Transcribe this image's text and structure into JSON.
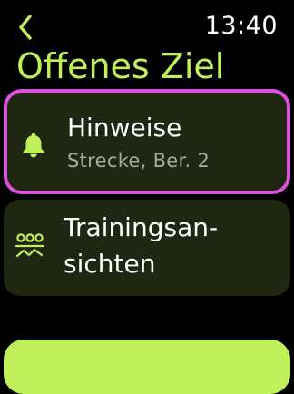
{
  "status_bar": {
    "back_icon": "chevron-left-icon",
    "time": "13:40"
  },
  "page": {
    "title": "Offenes Ziel"
  },
  "items": [
    {
      "icon": "bell-icon",
      "title": "Hinweise",
      "subtitle": "Strecke, Ber. 2",
      "selected": true
    },
    {
      "icon": "workout-views-icon",
      "title_line1": "Trainingsan-",
      "title_line2": "sichten"
    }
  ],
  "colors": {
    "accent": "#bff05a",
    "card_background": "#1f2611",
    "selection_border": "#e04ee4",
    "subtitle": "#a6ab9c"
  }
}
